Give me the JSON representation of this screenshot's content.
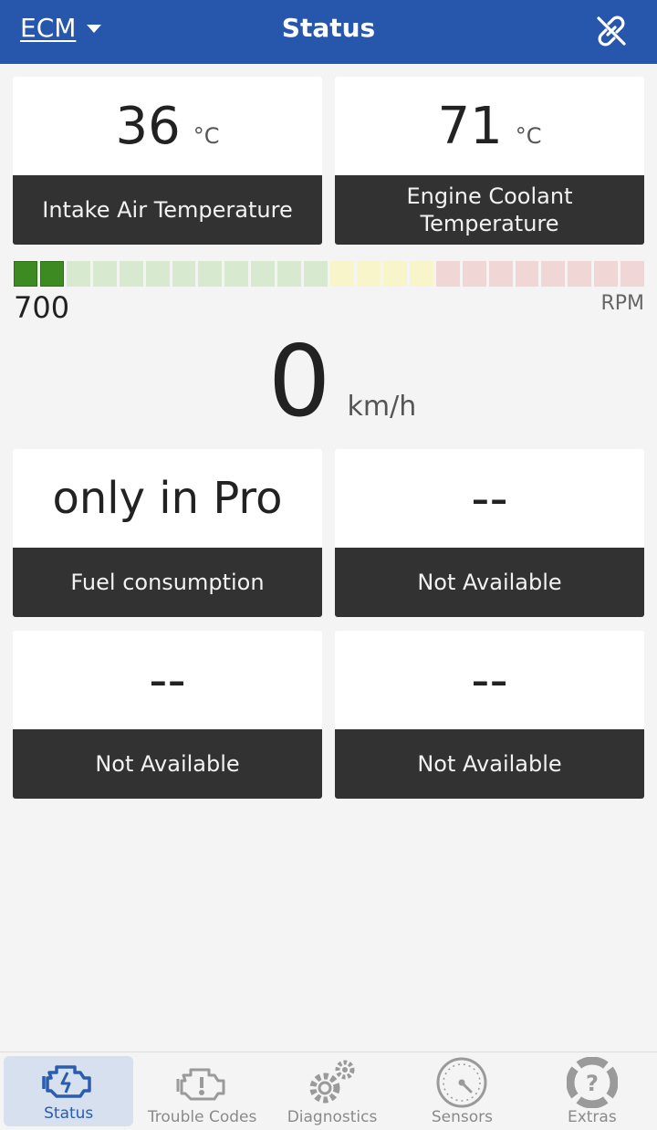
{
  "header": {
    "ecu_label": "ECM",
    "title": "Status"
  },
  "cards_top": [
    {
      "value": "36",
      "unit": "°C",
      "label": "Intake Air Temperature"
    },
    {
      "value": "71",
      "unit": "°C",
      "label": "Engine Coolant Temperature"
    }
  ],
  "rpm": {
    "value": "700",
    "label": "RPM",
    "segments_total": 24,
    "segments_lit": 2,
    "colors": {
      "lit": "#3d8a23",
      "green_dim": "#d7e9cf",
      "yellow_dim": "#f7f5c9",
      "red_dim": "#f1d6d6"
    }
  },
  "speed": {
    "value": "0",
    "unit": "km/h"
  },
  "cards_bottom": [
    {
      "value": "only in Pro",
      "label": "Fuel consumption"
    },
    {
      "value": "--",
      "label": "Not Available"
    },
    {
      "value": "--",
      "label": "Not Available"
    },
    {
      "value": "--",
      "label": "Not Available"
    }
  ],
  "nav": [
    {
      "label": "Status",
      "icon": "engine-icon",
      "active": true
    },
    {
      "label": "Trouble Codes",
      "icon": "engine-warning-icon",
      "active": false
    },
    {
      "label": "Diagnostics",
      "icon": "gears-icon",
      "active": false
    },
    {
      "label": "Sensors",
      "icon": "gauge-icon",
      "active": false
    },
    {
      "label": "Extras",
      "icon": "help-lifebuoy-icon",
      "active": false
    }
  ],
  "colors": {
    "header_bg": "#2657ad",
    "accent": "#2a5cb0",
    "label_bg": "#323232"
  }
}
